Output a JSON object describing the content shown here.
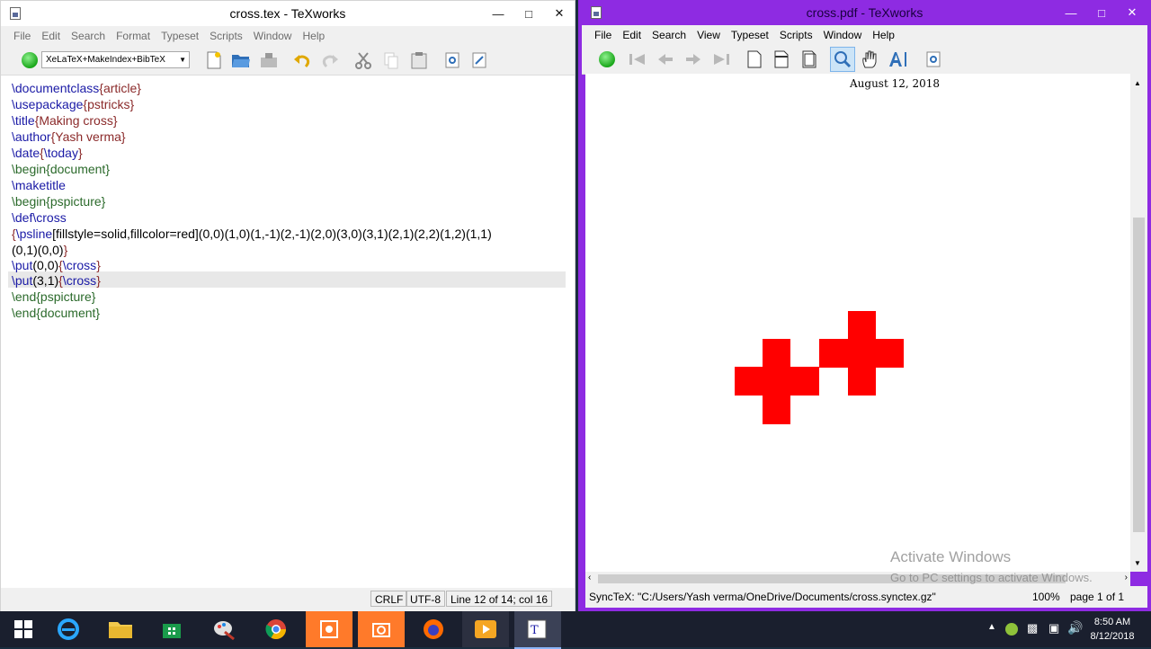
{
  "left_window": {
    "title": "cross.tex - TeXworks",
    "menu": [
      "File",
      "Edit",
      "Search",
      "Format",
      "Typeset",
      "Scripts",
      "Window",
      "Help"
    ],
    "typeset_engine": "XeLaTeX+MakeIndex+BibTeX",
    "code": {
      "l1a": "\\documentclass",
      "l1b": "{article}",
      "l2a": "\\usepackage",
      "l2b": "{pstricks}",
      "l3a": "\\title",
      "l3b": "{Making cross}",
      "l4a": "\\author",
      "l4b": "{Yash verma}",
      "l5a": "\\date",
      "l5b": "{",
      "l5c": "\\today",
      "l5d": "}",
      "l6a": "\\begin",
      "l6b": "{document}",
      "l7a": "\\maketitle",
      "l8a": "\\begin",
      "l8b": "{pspicture}",
      "l9a": "\\def\\cross",
      "l10a": "{",
      "l10b": "\\psline",
      "l10c": "[fillstyle=solid,fillcolor=red](0,0)(1,0)(1,-1)(2,-1)(2,0)(3,0)(3,1)(2,1)(2,2)(1,2)(1,1)",
      "l11a": "(0,1)(0,0)",
      "l11b": "}",
      "l12a": "\\put",
      "l12b": "(0,0)",
      "l12c": "{",
      "l12d": "\\cross",
      "l12e": "}",
      "l13a": "\\put",
      "l13b": "(3,1)",
      "l13c": "{",
      "l13d": "\\cross",
      "l13e": "}",
      "l14a": "\\end",
      "l14b": "{pspicture}",
      "l15a": "\\end",
      "l15b": "{document}"
    },
    "status": {
      "line_ending": "CRLF",
      "encoding": "UTF-8",
      "position": "Line 12 of 14; col 16"
    }
  },
  "right_window": {
    "title": "cross.pdf - TeXworks",
    "menu": [
      "File",
      "Edit",
      "Search",
      "View",
      "Typeset",
      "Scripts",
      "Window",
      "Help"
    ],
    "pdf_date": "August 12, 2018",
    "cross_color": "#ff0000",
    "synctex": "SyncTeX: \"C:/Users/Yash verma/OneDrive/Documents/cross.synctex.gz\"",
    "zoom": "100%",
    "page": "page 1 of 1"
  },
  "watermark": {
    "activate_title": "Activate Windows",
    "activate_sub": "Go to PC settings to activate Windows."
  },
  "taskbar": {
    "time": "8:50 AM",
    "date": "8/12/2018"
  },
  "colors": {
    "accent": "#8e2be2",
    "cross": "#ff0000"
  }
}
